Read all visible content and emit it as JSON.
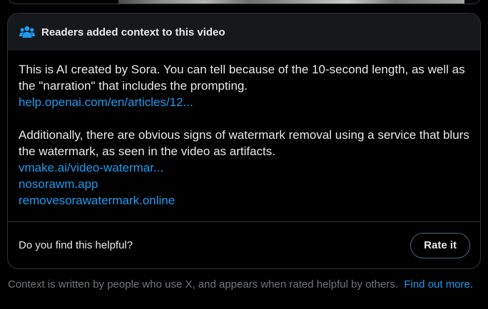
{
  "note": {
    "header_title": "Readers added context to this video",
    "header_icon": "people-icon",
    "paragraph1": "This is AI created by Sora.  You can tell because of the 10-second length, as well as the \"narration\" that includes the prompting.",
    "links1": [
      "help.openai.com/en/articles/12..."
    ],
    "paragraph2": "Additionally, there are obvious signs of watermark removal using a service that blurs the watermark, as seen in the video as artifacts.",
    "links2": [
      "vmake.ai/video-watermar...",
      "nosorawm.app",
      "removesorawatermark.online"
    ]
  },
  "rating": {
    "question": "Do you find this helpful?",
    "button_label": "Rate it"
  },
  "footer": {
    "text": "Context is written by people who use X, and appears when rated helpful by others.",
    "link_label": "Find out more."
  },
  "colors": {
    "background": "#000000",
    "header_background": "#16181c",
    "border": "#2f3336",
    "text": "#e7e9ea",
    "muted": "#71767b",
    "link": "#1d9bf0"
  }
}
